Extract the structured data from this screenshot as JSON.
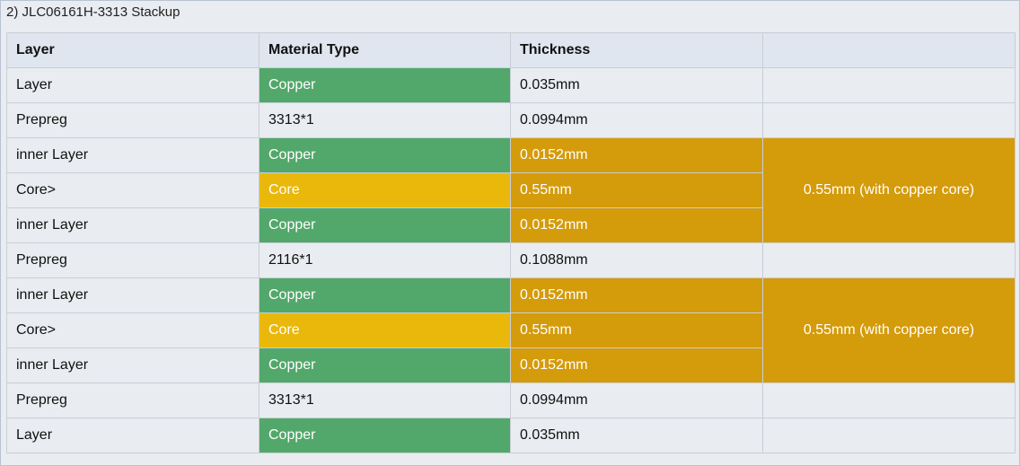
{
  "panel": {
    "title": "2) JLC06161H-3313 Stackup"
  },
  "colors": {
    "copper": "#52a86a",
    "core": "#e9b80b",
    "inner_thickness": "#d49b0b",
    "header_bg": "#dfe6ef"
  },
  "table": {
    "headers": [
      "Layer",
      "Material Type",
      "Thickness",
      ""
    ],
    "rows": [
      {
        "layer": "Layer",
        "material": "Copper",
        "thickness": "0.035mm"
      },
      {
        "layer": "Prepreg",
        "material": "3313*1",
        "thickness": "0.0994mm"
      },
      {
        "layer": "inner Layer",
        "material": "Copper",
        "thickness": "0.0152mm"
      },
      {
        "layer": "Core>",
        "material": "Core",
        "thickness": "0.55mm"
      },
      {
        "layer": "inner Layer",
        "material": "Copper",
        "thickness": "0.0152mm"
      },
      {
        "layer": "Prepreg",
        "material": "2116*1",
        "thickness": "0.1088mm"
      },
      {
        "layer": "inner Layer",
        "material": "Copper",
        "thickness": "0.0152mm"
      },
      {
        "layer": "Core>",
        "material": "Core",
        "thickness": "0.55mm"
      },
      {
        "layer": "inner Layer",
        "material": "Copper",
        "thickness": "0.0152mm"
      },
      {
        "layer": "Prepreg",
        "material": "3313*1",
        "thickness": "0.0994mm"
      },
      {
        "layer": "Layer",
        "material": "Copper",
        "thickness": "0.035mm"
      }
    ],
    "core_groups": [
      {
        "label": "0.55mm (with copper core)"
      },
      {
        "label": "0.55mm (with copper core)"
      }
    ]
  }
}
